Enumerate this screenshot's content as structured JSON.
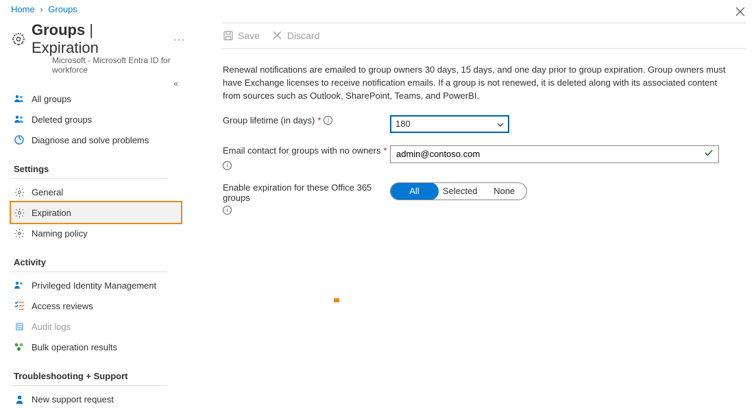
{
  "breadcrumb": {
    "home": "Home",
    "groups": "Groups"
  },
  "header": {
    "title_main": "Groups",
    "title_sub": "Expiration",
    "subtitle": "Microsoft - Microsoft Entra ID for workforce"
  },
  "nav": {
    "top": [
      {
        "label": "All groups"
      },
      {
        "label": "Deleted groups"
      },
      {
        "label": "Diagnose and solve problems"
      }
    ],
    "settings_label": "Settings",
    "settings": [
      {
        "label": "General"
      },
      {
        "label": "Expiration"
      },
      {
        "label": "Naming policy"
      }
    ],
    "activity_label": "Activity",
    "activity": [
      {
        "label": "Privileged Identity Management"
      },
      {
        "label": "Access reviews"
      },
      {
        "label": "Audit logs"
      },
      {
        "label": "Bulk operation results"
      }
    ],
    "support_label": "Troubleshooting + Support",
    "support": [
      {
        "label": "New support request"
      }
    ]
  },
  "toolbar": {
    "save": "Save",
    "discard": "Discard"
  },
  "description": "Renewal notifications are emailed to group owners 30 days, 15 days, and one day prior to group expiration. Group owners must have Exchange licenses to receive notification emails. If a group is not renewed, it is deleted along with its associated content from sources such as Outlook, SharePoint, Teams, and PowerBI.",
  "form": {
    "lifetime_label": "Group lifetime (in days)",
    "lifetime_value": "180",
    "email_label": "Email contact for groups with no owners",
    "email_value": "admin@contoso.com",
    "enable_label": "Enable expiration for these Office 365 groups",
    "option_all": "All",
    "option_selected": "Selected",
    "option_none": "None"
  }
}
